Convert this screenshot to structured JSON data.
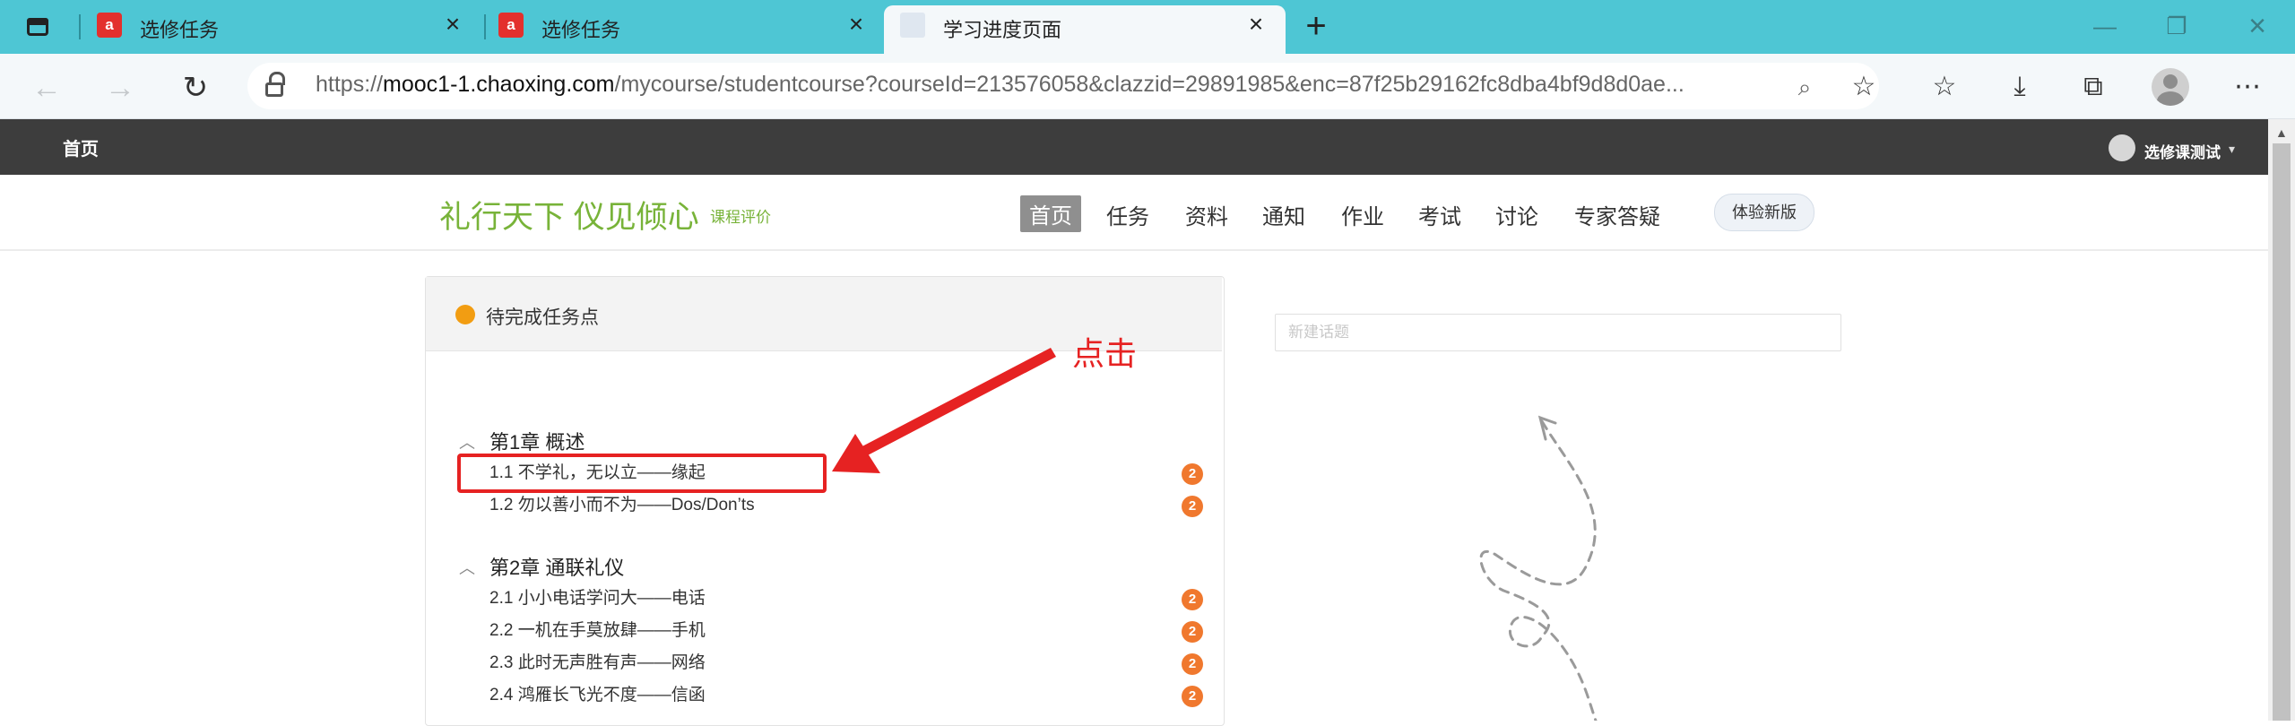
{
  "browser": {
    "tabs": [
      {
        "title": "选修任务",
        "favicon": "chaoxing-logo-icon",
        "active": false
      },
      {
        "title": "选修任务",
        "favicon": "chaoxing-logo-icon",
        "active": false
      },
      {
        "title": "学习进度页面",
        "favicon": "page-icon",
        "active": true
      }
    ],
    "url_prefix": "https://",
    "url_host": "mooc1-1.chaoxing.com",
    "url_rest": "/mycourse/studentcourse?courseId=213576058&clazzid=29891985&enc=87f25b29162fc8dba4bf9d8d0ae...",
    "favicon_letter": "ⓐ"
  },
  "site": {
    "home": "首页",
    "user_name": "选修课测试",
    "course_title": "礼行天下 仪见倾心",
    "course_eval": "课程评价",
    "nav": [
      "首页",
      "任务",
      "资料",
      "通知",
      "作业",
      "考试",
      "讨论",
      "专家答疑"
    ],
    "new_version": "体验新版"
  },
  "task_panel": {
    "header": "待完成任务点",
    "chapters": [
      {
        "title": "第1章 概述",
        "sections": [
          {
            "title": "1.1  不学礼，无以立——缘起",
            "count": "2"
          },
          {
            "title": "1.2  勿以善小而不为——Dos/Don’ts",
            "count": "2"
          }
        ]
      },
      {
        "title": "第2章 通联礼仪",
        "sections": [
          {
            "title": "2.1  小小电话学问大——电话",
            "count": "2"
          },
          {
            "title": "2.2  一机在手莫放肆——手机",
            "count": "2"
          },
          {
            "title": "2.3  此时无声胜有声——网络",
            "count": "2"
          },
          {
            "title": "2.4  鸿雁长飞光不度——信函",
            "count": "2"
          }
        ]
      }
    ]
  },
  "notes": {
    "placeholder": "新建话题"
  },
  "annotation": {
    "text": "点击",
    "color": "#e62222"
  },
  "colors": {
    "tab_bar": "#4ec6d4",
    "site_header": "#3d3d3d",
    "course_green": "#78b339",
    "badge": "#f0782e"
  }
}
